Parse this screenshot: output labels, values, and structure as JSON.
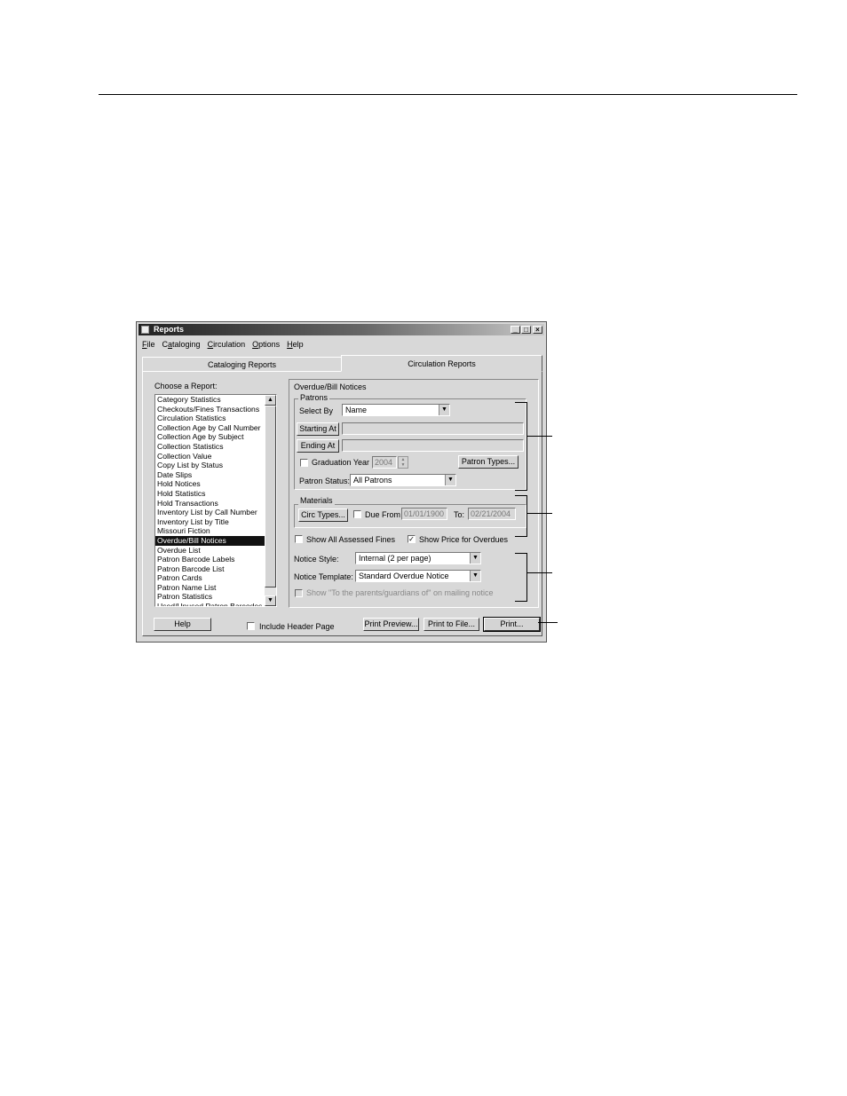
{
  "window": {
    "title": "Reports",
    "controls": [
      "_",
      "□",
      "×"
    ]
  },
  "menu": [
    {
      "label": "File",
      "u": "F",
      "rest": "ile"
    },
    {
      "label": "Cataloging",
      "pre": "C",
      "u": "a",
      "rest": "taloging"
    },
    {
      "label": "Circulation",
      "u": "C",
      "rest": "irculation"
    },
    {
      "label": "Options",
      "u": "O",
      "rest": "ptions"
    },
    {
      "label": "Help",
      "u": "H",
      "rest": "elp"
    }
  ],
  "tabs": {
    "cataloging": "Cataloging Reports",
    "circulation": "Circulation Reports"
  },
  "choose_label": "Choose a Report:",
  "reports": [
    "Category Statistics",
    "Checkouts/Fines Transactions",
    "Circulation Statistics",
    "Collection Age by Call Number",
    "Collection Age by Subject",
    "Collection Statistics",
    "Collection Value",
    "Copy List by Status",
    "Date Slips",
    "Hold Notices",
    "Hold Statistics",
    "Hold Transactions",
    "Inventory List by Call Number",
    "Inventory List by Title",
    "Missouri Fiction",
    "Overdue/Bill Notices",
    "Overdue List",
    "Patron Barcode Labels",
    "Patron Barcode List",
    "Patron Cards",
    "Patron Name List",
    "Patron Statistics",
    "Used/Unused Patron Barcodes"
  ],
  "selected_report": "Overdue/Bill Notices",
  "options": {
    "heading": "Overdue/Bill Notices",
    "patrons": {
      "group_title": "Patrons",
      "select_by_label": "Select By",
      "select_by_value": "Name",
      "starting_at": "Starting At",
      "ending_at": "Ending At",
      "graduation_year_label": "Graduation Year",
      "graduation_year_value": "2004",
      "patron_types_button": "Patron Types...",
      "patron_status_label": "Patron Status:",
      "patron_status_value": "All Patrons"
    },
    "materials": {
      "group_title": "Materials",
      "circ_types_button": "Circ Types...",
      "due_from_label": "Due From",
      "due_from_value": "01/01/1900",
      "to_label": "To:",
      "to_value": "02/21/2004"
    },
    "show_all_fines": "Show All Assessed Fines",
    "show_price": "Show Price for Overdues",
    "show_price_checked": true,
    "notice_style_label": "Notice Style:",
    "notice_style_value": "Internal (2 per page)",
    "notice_template_label": "Notice Template:",
    "notice_template_value": "Standard Overdue Notice",
    "parents_label": "Show \"To the parents/guardians of\" on mailing notice"
  },
  "footer": {
    "help": "Help",
    "include_header": "Include Header Page",
    "print_preview": "Print Preview...",
    "print_to_file": "Print to File...",
    "print": "Print..."
  }
}
